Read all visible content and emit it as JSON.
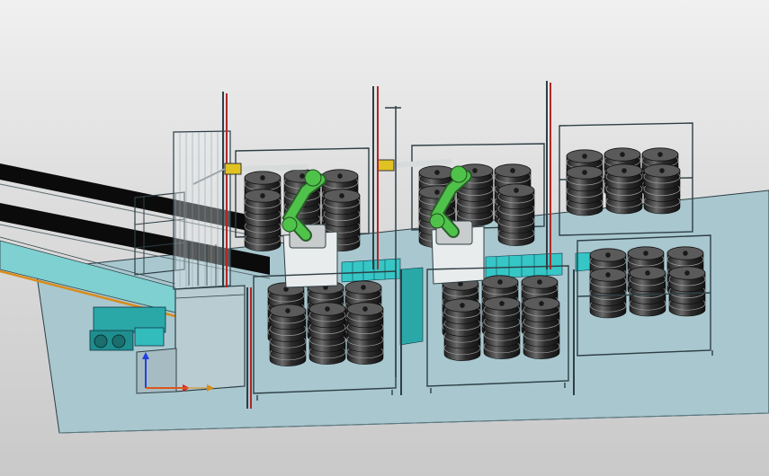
{
  "viewport": {
    "background_top": "#f0f0f0",
    "background_bottom": "#c9c9c9"
  },
  "scene": {
    "floor_color": "#a9c7cf",
    "frame_color": "#2e3f45",
    "barrel_color": "#3b3b3b",
    "robot_color": "#4fc24a",
    "conveyor_color": "#36c6c6",
    "rail_color": "#d98c1a",
    "pillar_accent_color": "#b02828",
    "robot_count": 2,
    "pallet_station_count": 4
  },
  "triad": {
    "x_axis_color": "#e02020",
    "y_axis_color": "#20a020",
    "z_axis_color": "#2040e0"
  }
}
